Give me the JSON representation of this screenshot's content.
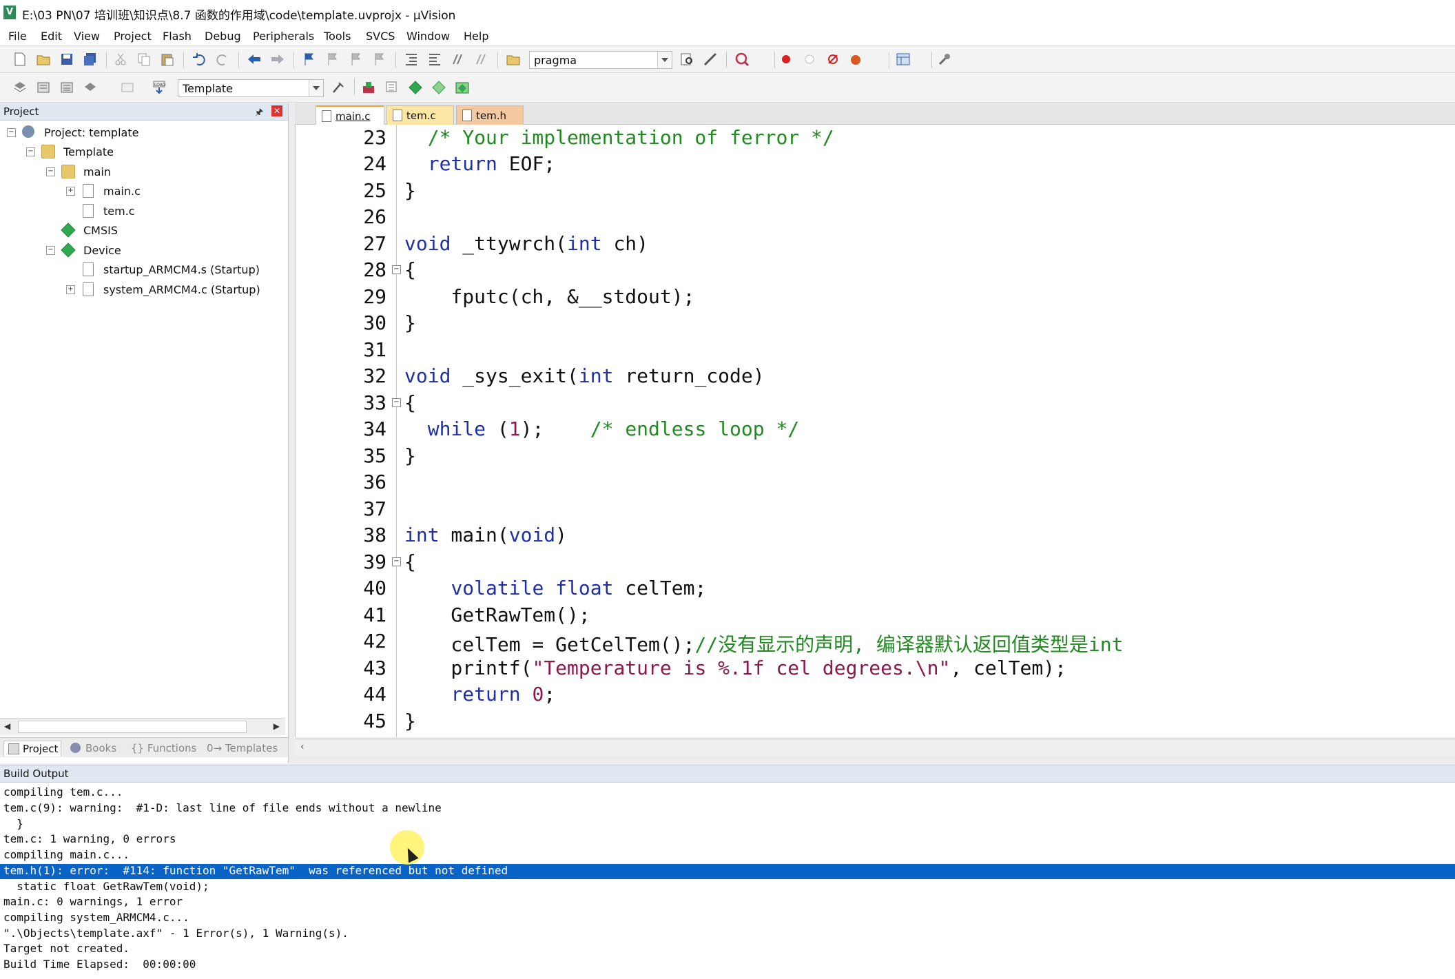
{
  "window": {
    "title": "E:\\03 PN\\07 培训班\\知识点\\8.7 函数的作用域\\code\\template.uvprojx - µVision"
  },
  "menu": [
    "File",
    "Edit",
    "View",
    "Project",
    "Flash",
    "Debug",
    "Peripherals",
    "Tools",
    "SVCS",
    "Window",
    "Help"
  ],
  "toolbar1": {
    "find_value": "pragma"
  },
  "toolbar2": {
    "target_value": "Template"
  },
  "project_panel": {
    "title": "Project",
    "tree": [
      {
        "label": "Project: template"
      },
      {
        "label": "Template"
      },
      {
        "label": "main"
      },
      {
        "label": "main.c"
      },
      {
        "label": "tem.c"
      },
      {
        "label": "CMSIS"
      },
      {
        "label": "Device"
      },
      {
        "label": "startup_ARMCM4.s (Startup)"
      },
      {
        "label": "system_ARMCM4.c (Startup)"
      }
    ],
    "tabs": [
      "Project",
      "Books",
      "{} Functions",
      "0→ Templates"
    ]
  },
  "editor": {
    "tabs": [
      "main.c",
      "tem.c",
      "tem.h"
    ],
    "lines": [
      {
        "n": "23",
        "code": "  /* Your implementation of ferror */"
      },
      {
        "n": "24",
        "code": "  return EOF;"
      },
      {
        "n": "25",
        "code": "}"
      },
      {
        "n": "26",
        "code": ""
      },
      {
        "n": "27",
        "code": "void _ttywrch(int ch)"
      },
      {
        "n": "28",
        "code": "{"
      },
      {
        "n": "29",
        "code": "    fputc(ch, &__stdout);"
      },
      {
        "n": "30",
        "code": "}"
      },
      {
        "n": "31",
        "code": ""
      },
      {
        "n": "32",
        "code": "void _sys_exit(int return_code)"
      },
      {
        "n": "33",
        "code": "{"
      },
      {
        "n": "34",
        "code": "  while (1);    /* endless loop */"
      },
      {
        "n": "35",
        "code": "}"
      },
      {
        "n": "36",
        "code": ""
      },
      {
        "n": "37",
        "code": ""
      },
      {
        "n": "38",
        "code": "int main(void)"
      },
      {
        "n": "39",
        "code": "{"
      },
      {
        "n": "40",
        "code": "    volatile float celTem;"
      },
      {
        "n": "41",
        "code": "    GetRawTem();"
      },
      {
        "n": "42",
        "code": "    celTem = GetCelTem();//没有显示的声明, 编译器默认返回值类型是int"
      },
      {
        "n": "43",
        "code": "    printf(\"Temperature is %.1f cel degrees.\\n\", celTem);"
      },
      {
        "n": "44",
        "code": "    return 0;"
      },
      {
        "n": "45",
        "code": "}"
      }
    ]
  },
  "build_output": {
    "title": "Build Output",
    "lines": [
      "compiling tem.c...",
      "tem.c(9): warning:  #1-D: last line of file ends without a newline",
      "  }",
      "tem.c: 1 warning, 0 errors",
      "compiling main.c...",
      "tem.h(1): error:  #114: function \"GetRawTem\"  was referenced but not defined",
      "  static float GetRawTem(void);",
      "main.c: 0 warnings, 1 error",
      "compiling system_ARMCM4.c...",
      "\".\\Objects\\template.axf\" - 1 Error(s), 1 Warning(s).",
      "Target not created.",
      "Build Time Elapsed:  00:00:00"
    ]
  },
  "colors": {
    "keyword": "#1e2fa8",
    "comment": "#1f8a1f",
    "string": "#8b1a4a",
    "selection": "#0a64c8"
  }
}
